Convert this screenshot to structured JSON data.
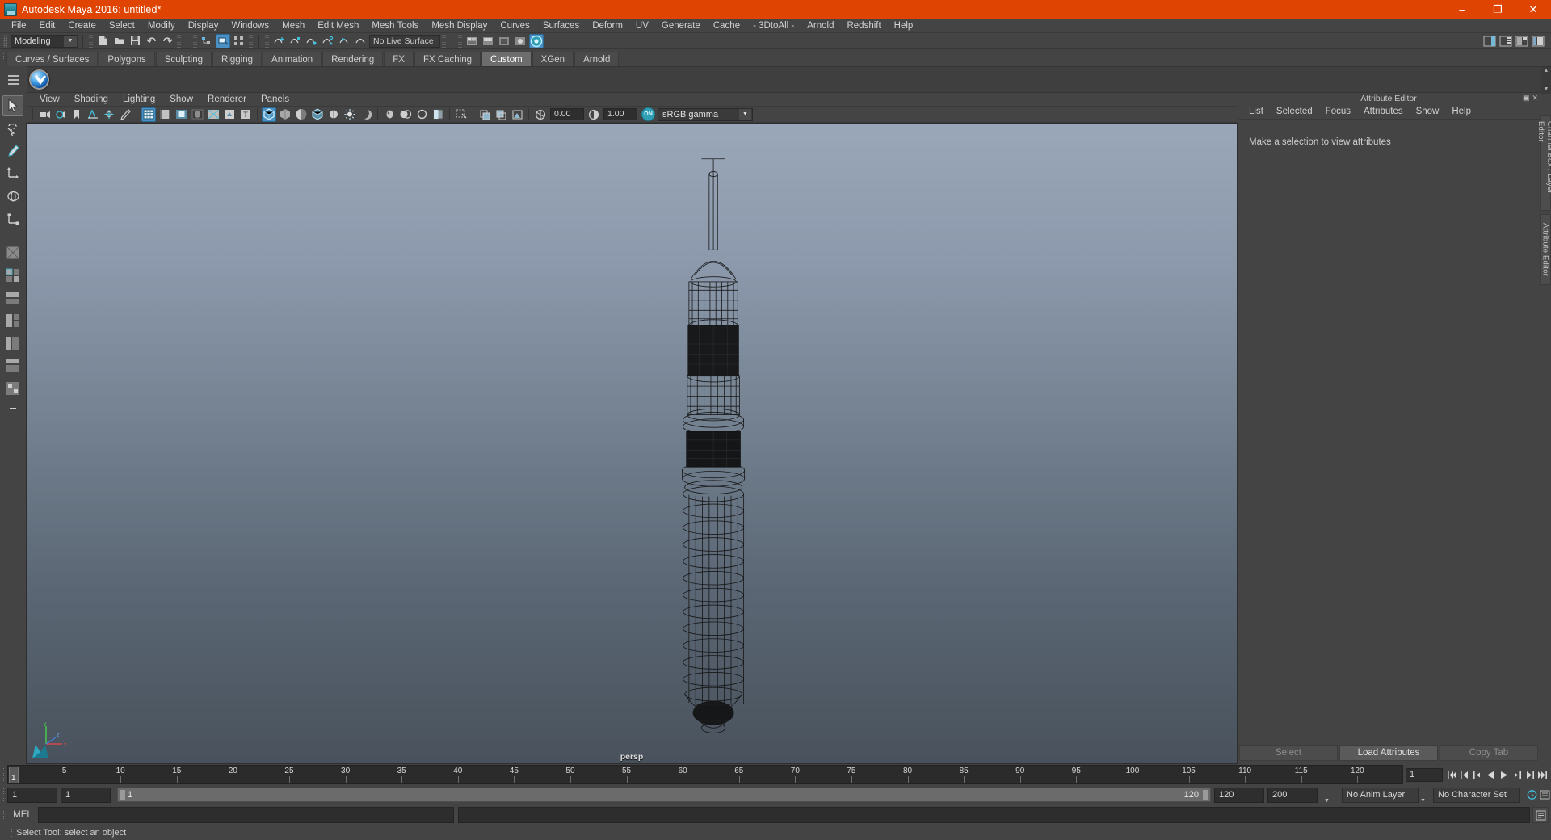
{
  "window": {
    "title": "Autodesk Maya 2016: untitled*",
    "app_icon": "maya-app-icon",
    "minimize": "–",
    "maximize": "❐",
    "close": "✕",
    "accent_color": "#e04403"
  },
  "menubar": {
    "items": [
      "File",
      "Edit",
      "Create",
      "Select",
      "Modify",
      "Display",
      "Windows",
      "Mesh",
      "Edit Mesh",
      "Mesh Tools",
      "Mesh Display",
      "Curves",
      "Surfaces",
      "Deform",
      "UV",
      "Generate",
      "Cache",
      "- 3DtoAll -",
      "Arnold",
      "Redshift",
      "Help"
    ]
  },
  "statusbar": {
    "menu_set": "Modeling",
    "menu_set_arrow": "▼",
    "live_surface": "No Live Surface",
    "icons": [
      "new-scene-icon",
      "open-scene-icon",
      "save-scene-icon",
      "undo-icon",
      "redo-icon",
      "select-by-hierarchy-icon",
      "select-by-object-icon",
      "select-by-component-icon",
      "snap-to-grid-icon",
      "snap-to-curve-icon",
      "snap-to-point-icon",
      "snap-to-projected-center-icon",
      "snap-to-view-plane-icon",
      "make-live-icon"
    ],
    "right_icons": [
      "show-hide-editor-icon",
      "channel-box-icon",
      "layer-editor-icon",
      "attribute-editor-icon"
    ]
  },
  "shelf": {
    "tabs": [
      {
        "label": "Curves / Surfaces",
        "active": false
      },
      {
        "label": "Polygons",
        "active": false
      },
      {
        "label": "Sculpting",
        "active": false
      },
      {
        "label": "Rigging",
        "active": false
      },
      {
        "label": "Animation",
        "active": false
      },
      {
        "label": "Rendering",
        "active": false
      },
      {
        "label": "FX",
        "active": false
      },
      {
        "label": "FX Caching",
        "active": false
      },
      {
        "label": "Custom",
        "active": true
      },
      {
        "label": "XGen",
        "active": false
      },
      {
        "label": "Arnold",
        "active": false
      }
    ],
    "button_icon": "maya-blue-check-orb-icon",
    "scroll_up": "▲",
    "scroll_down": "▼"
  },
  "toolbox": {
    "tools": [
      "select-tool-icon",
      "lasso-select-tool-icon",
      "paint-select-tool-icon",
      "move-tool-icon",
      "rotate-tool-icon",
      "scale-tool-icon"
    ],
    "layouts": [
      "single-perspective-layout-icon",
      "four-view-layout-icon",
      "two-pane-stacked-layout-icon",
      "three-pane-layout-icon",
      "outliner-persp-layout-icon",
      "hypershade-layout-icon",
      "persp-graph-layout-icon",
      "more-layouts-icon"
    ]
  },
  "panel": {
    "menus": [
      "View",
      "Shading",
      "Lighting",
      "Show",
      "Renderer",
      "Panels"
    ],
    "toolbar_icons": [
      "select-camera-icon",
      "camera-attributes-icon",
      "bookmark-icon",
      "image-plane-icon",
      "2d-pan-zoom-icon",
      "grease-pencil-icon",
      "grid-icon",
      "film-gate-icon",
      "resolution-gate-icon",
      "gate-mask-icon",
      "exposure-icon",
      "xray-icon",
      "texture-icon",
      "wireframe-icon",
      "smooth-shade-icon",
      "smooth-shade-all-icon",
      "shaded-wireframe-icon",
      "lighting-icon",
      "shadows-icon",
      "screen-space-ao-icon",
      "motion-blur-icon",
      "anti-alias-icon",
      "multisample-icon",
      "isolate-select-icon",
      "xray-joints-icon",
      "xray-active-icon",
      "exposure-gamma-icon"
    ],
    "exposure_value": "0.00",
    "gamma_value": "1.00",
    "color_management_toggle": "ON",
    "view_transform": "sRGB gamma",
    "view_transform_arrow": "▼",
    "camera_label": "persp",
    "axis_labels": {
      "y": "y",
      "x": "x",
      "z": "z"
    }
  },
  "attribute_editor": {
    "title": "Attribute Editor",
    "float_icon": "▣",
    "close_icon": "✕",
    "menus": [
      "List",
      "Selected",
      "Focus",
      "Attributes",
      "Show",
      "Help"
    ],
    "empty_message": "Make a selection to view attributes",
    "footer_buttons": [
      {
        "label": "Select",
        "enabled": false
      },
      {
        "label": "Load Attributes",
        "enabled": true
      },
      {
        "label": "Copy Tab",
        "enabled": false
      }
    ]
  },
  "side_tabs": [
    "Channel Box / Layer Editor",
    "Attribute Editor"
  ],
  "timeline": {
    "ticks": [
      5,
      10,
      15,
      20,
      25,
      30,
      35,
      40,
      45,
      50,
      55,
      60,
      65,
      70,
      75,
      80,
      85,
      90,
      95,
      100,
      105,
      110,
      115,
      120
    ],
    "current_frame": "1",
    "current_frame_field": "1",
    "range_start": "1",
    "range_end": "1",
    "slider_start": "1",
    "slider_end": "120",
    "playback_start": "120",
    "playback_end": "200",
    "anim_layer": "No Anim Layer",
    "character_set": "No Character Set",
    "playback_buttons": [
      "go-to-start-icon",
      "step-back-frame-icon",
      "step-back-key-icon",
      "play-backwards-icon",
      "play-forwards-icon",
      "step-forward-key-icon",
      "step-forward-frame-icon",
      "go-to-end-icon"
    ],
    "anim_prefs_icon": "animation-preferences-icon",
    "playback_arrow": "▼"
  },
  "command_line": {
    "language_label": "MEL",
    "input_value": "",
    "output_value": "",
    "script_editor_icon": "script-editor-icon"
  },
  "help_line": {
    "message": "Select Tool: select an object"
  }
}
